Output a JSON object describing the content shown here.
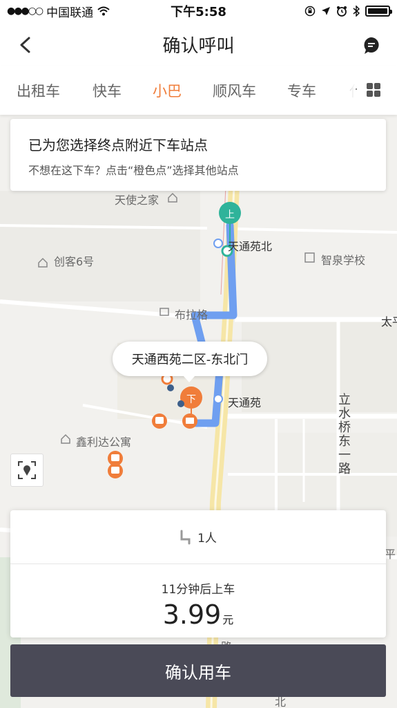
{
  "status_bar": {
    "signal": "●●●○○",
    "carrier": "中国联通",
    "time": "下午5:58",
    "battery_level": 1.0
  },
  "nav": {
    "title": "确认呼叫",
    "back_icon": "chevron-left-icon",
    "message_icon": "chat-bubble-icon"
  },
  "tabs": [
    {
      "label": "出租车",
      "active": false
    },
    {
      "label": "快车",
      "active": false
    },
    {
      "label": "小巴",
      "active": true
    },
    {
      "label": "顺风车",
      "active": false
    },
    {
      "label": "专车",
      "active": false
    },
    {
      "label": "代",
      "active": false
    }
  ],
  "hint": {
    "title": "已为您选择终点附近下车站点",
    "subtitle": "不想在这下车？点击“橙色点”选择其他站点"
  },
  "map": {
    "labels": {
      "tianshi": "天使之家",
      "tiantong_north": "天通苑北",
      "chuangke": "创客6号",
      "zhiquan": "智泉学校",
      "bulage": "布拉格",
      "tiantong": "天通苑",
      "xinlida": "鑫利达公寓",
      "lishuiqiao": "立水桥东一路",
      "tai": "太平",
      "ping": "平",
      "lu": "路",
      "bei": "北"
    },
    "pickup_marker": "上",
    "dropoff_marker": "下",
    "callout": "天通西苑二区-东北门",
    "route_color": "#6f9ff0",
    "accent_green": "#2fb39a",
    "accent_orange": "#f07d3a"
  },
  "ride": {
    "seats": "1人",
    "eta": "11分钟后上车",
    "price": "3.99",
    "unit": "元"
  },
  "confirm_label": "确认用车"
}
